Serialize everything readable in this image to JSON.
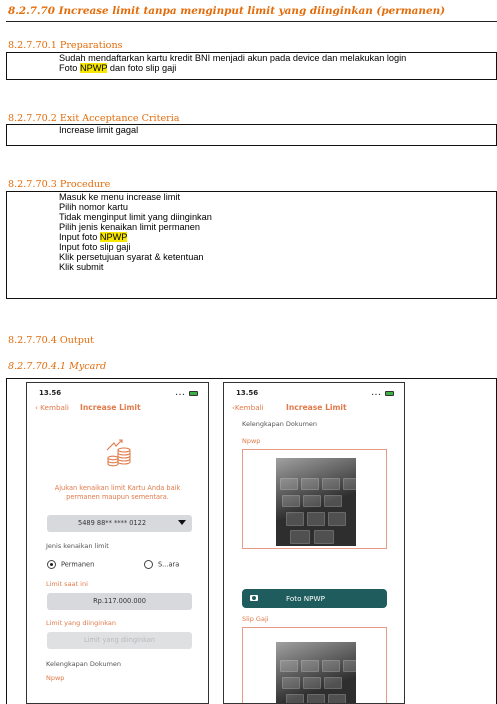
{
  "heading_main": "8.2.7.70  Increase limit tanpa menginput limit yang diinginkan (permanen)",
  "sections": {
    "preparations": {
      "title": "8.2.7.70.1   Preparations",
      "items": [
        {
          "pre": "Sudah mendaftarkan kartu kredit BNI menjadi akun pada device dan melakukan login",
          "hl": "",
          "post": ""
        },
        {
          "pre": "Foto ",
          "hl": "NPWP",
          "post": " dan foto slip gaji"
        }
      ]
    },
    "exit_criteria": {
      "title": "8.2.7.70.2   Exit Acceptance Criteria",
      "items": [
        "Increase limit gagal"
      ]
    },
    "procedure": {
      "title": "8.2.7.70.3   Procedure",
      "items": [
        {
          "pre": "Masuk ke menu increase limit",
          "hl": "",
          "post": ""
        },
        {
          "pre": "Pilih nomor kartu",
          "hl": "",
          "post": ""
        },
        {
          "pre": "Tidak menginput limit yang diinginkan",
          "hl": "",
          "post": ""
        },
        {
          "pre": "Pilih jenis kenaikan limit permanen",
          "hl": "",
          "post": ""
        },
        {
          "pre": "Input foto ",
          "hl": "NPWP",
          "post": ""
        },
        {
          "pre": "Input foto slip gaji",
          "hl": "",
          "post": ""
        },
        {
          "pre": "Klik persetujuan syarat & ketentuan",
          "hl": "",
          "post": ""
        },
        {
          "pre": "Klik submit",
          "hl": "",
          "post": ""
        }
      ]
    },
    "output": {
      "title": "8.2.7.70.4   Output"
    },
    "mycard": {
      "title": "8.2.7.70.4.1   Mycard"
    }
  },
  "screen1": {
    "time": "13.56",
    "status_icons": "... ",
    "back_label": "Kembali",
    "title": "Increase Limit",
    "caption": "Ajukan kenaikan limit Kartu Anda baik permanen maupun sementara.",
    "card_number": "5489 88** **** 0122",
    "jenis_label": "Jenis kenaikan limit",
    "opt_permanen": "Permanen",
    "opt_sementara": "S...ara",
    "limit_now_label": "Limit saat ini",
    "limit_now_value": "Rp.117.000.000",
    "limit_want_label": "Limit yang diinginkan",
    "limit_want_placeholder": "Limit yang diinginkan",
    "docs_label": "Kelengkapan Dokumen",
    "npwp_label": "Npwp"
  },
  "screen2": {
    "time": "13.56",
    "status_icons": "... ",
    "back_label": "Kembali",
    "title": "Increase Limit",
    "docs_label": "Kelengkapan Dokumen",
    "npwp_label": "Npwp",
    "foto_button": "Foto NPWP",
    "slip_label": "Slip Gaji"
  },
  "colors": {
    "heading": "#e36c0a",
    "app_accent": "#e07a4a",
    "button": "#1f5c5e",
    "highlight": "#f6e600"
  }
}
